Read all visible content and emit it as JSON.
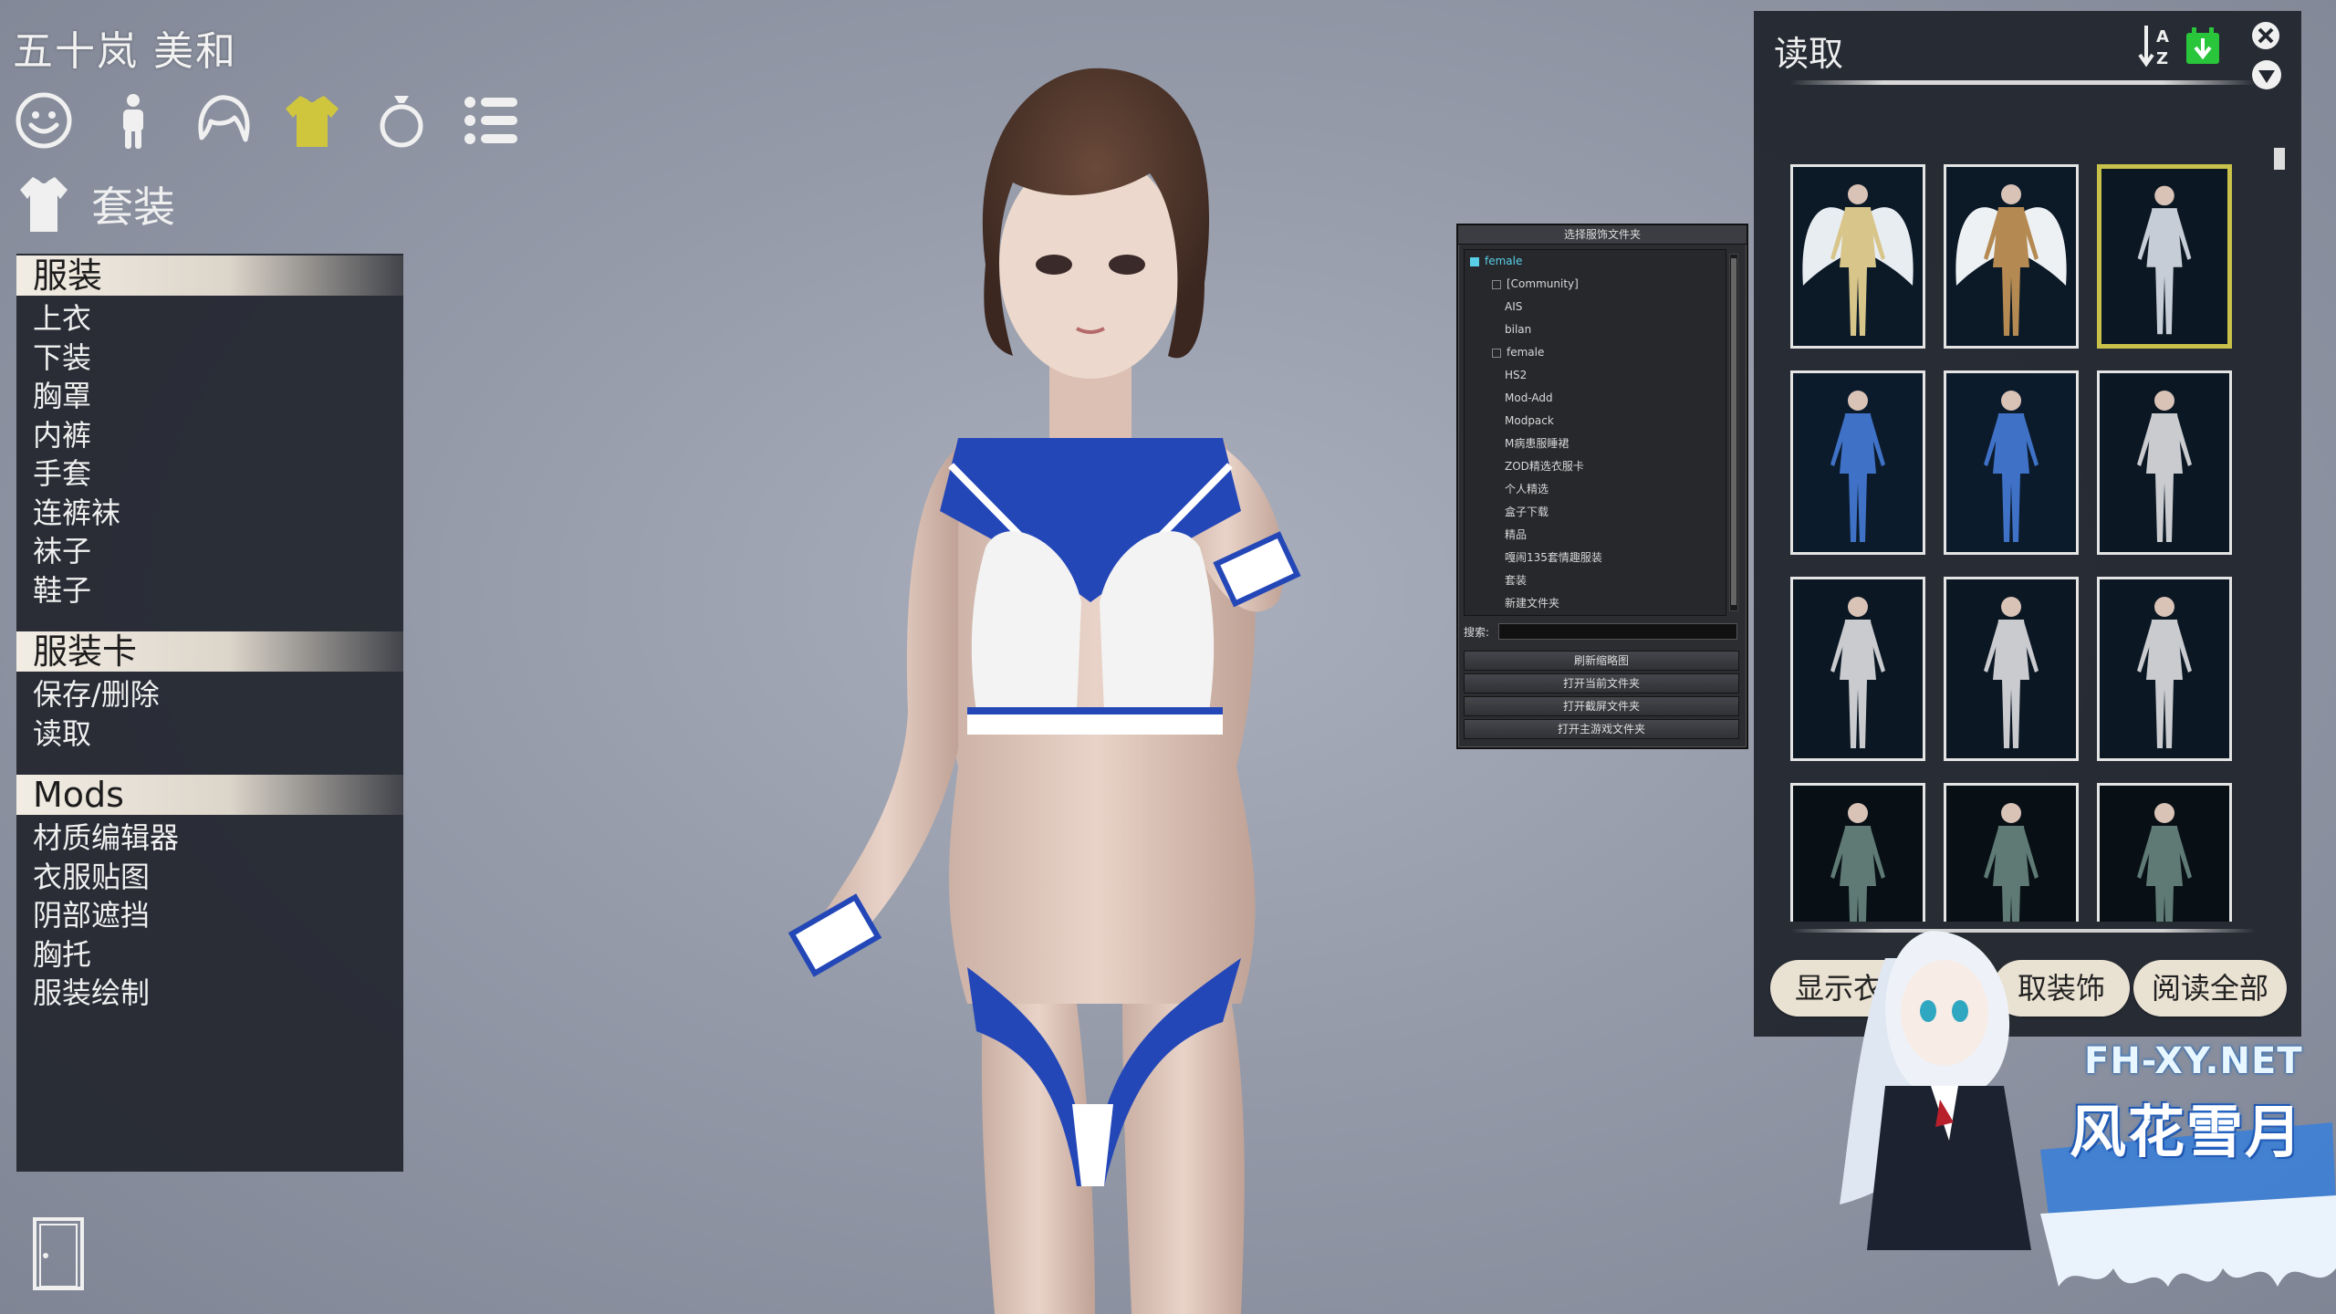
{
  "character": {
    "name": "五十岚 美和"
  },
  "categories": [
    {
      "name": "face",
      "icon": "face-icon"
    },
    {
      "name": "body",
      "icon": "body-icon"
    },
    {
      "name": "hair",
      "icon": "hair-icon"
    },
    {
      "name": "clothes",
      "icon": "shirt-icon",
      "active": true
    },
    {
      "name": "accessory",
      "icon": "ring-icon"
    },
    {
      "name": "system",
      "icon": "list-icon"
    }
  ],
  "subcategory": {
    "label": "套装",
    "icon": "shirt-icon"
  },
  "left_menu": {
    "sections": [
      {
        "header": "服装",
        "items": [
          "上衣",
          "下装",
          "胸罩",
          "内裤",
          "手套",
          "连裤袜",
          "袜子",
          "鞋子"
        ]
      },
      {
        "header": "服装卡",
        "items": [
          "保存/删除",
          "读取"
        ]
      },
      {
        "header": "Mods",
        "items": [
          "材质编辑器",
          "衣服贴图",
          "阴部遮挡",
          "胸托",
          "服装绘制"
        ]
      }
    ]
  },
  "folder_window": {
    "title": "选择服饰文件夹",
    "tree": [
      {
        "label": "female",
        "level": 0,
        "selected": true
      },
      {
        "label": "[Community]",
        "level": 1,
        "expandable": true
      },
      {
        "label": "AIS",
        "level": 1
      },
      {
        "label": "bilan",
        "level": 1
      },
      {
        "label": "female",
        "level": 1,
        "expandable": true
      },
      {
        "label": "HS2",
        "level": 1
      },
      {
        "label": "Mod-Add",
        "level": 1
      },
      {
        "label": "Modpack",
        "level": 1
      },
      {
        "label": "M病患服睡裙",
        "level": 1
      },
      {
        "label": "ZOD精选衣服卡",
        "level": 1
      },
      {
        "label": "个人精选",
        "level": 1
      },
      {
        "label": "盒子下载",
        "level": 1
      },
      {
        "label": "精品",
        "level": 1
      },
      {
        "label": "嘎闹135套情趣服装",
        "level": 1
      },
      {
        "label": "套装",
        "level": 1
      },
      {
        "label": "新建文件夹",
        "level": 1
      }
    ],
    "search_label": "搜索:",
    "search_value": "",
    "buttons": [
      "刷新缩略图",
      "打开当前文件夹",
      "打开截屏文件夹",
      "打开主游戏文件夹"
    ]
  },
  "load_panel": {
    "title": "读取",
    "thumbnails": [
      {
        "style": "angel-gold",
        "selected": false
      },
      {
        "style": "angel-bronze",
        "selected": false
      },
      {
        "style": "swimsuit",
        "selected": true
      },
      {
        "style": "blue-dress",
        "selected": false
      },
      {
        "style": "blue-dress",
        "selected": false
      },
      {
        "style": "white-figure",
        "selected": false
      },
      {
        "style": "white-figure",
        "selected": false
      },
      {
        "style": "white-figure",
        "selected": false
      },
      {
        "style": "white-figure",
        "selected": false
      },
      {
        "style": "dark-armor",
        "selected": false
      },
      {
        "style": "dark-armor",
        "selected": false
      },
      {
        "style": "dark-armor",
        "selected": false
      }
    ],
    "buttons": {
      "show_clothes": "显示衣服",
      "take_accessory": "取装饰",
      "read_all": "阅读全部"
    }
  },
  "watermark": {
    "url": "FH-XY.NET",
    "name": "风花雪月"
  },
  "colors": {
    "panel_bg": "#22262e",
    "section_header": "#e6dfd4",
    "selected_thumb_border": "#c8c14a",
    "active_category": "#cfc63e",
    "import_icon": "#29c53a",
    "button_bg": "#e9e1d2"
  }
}
